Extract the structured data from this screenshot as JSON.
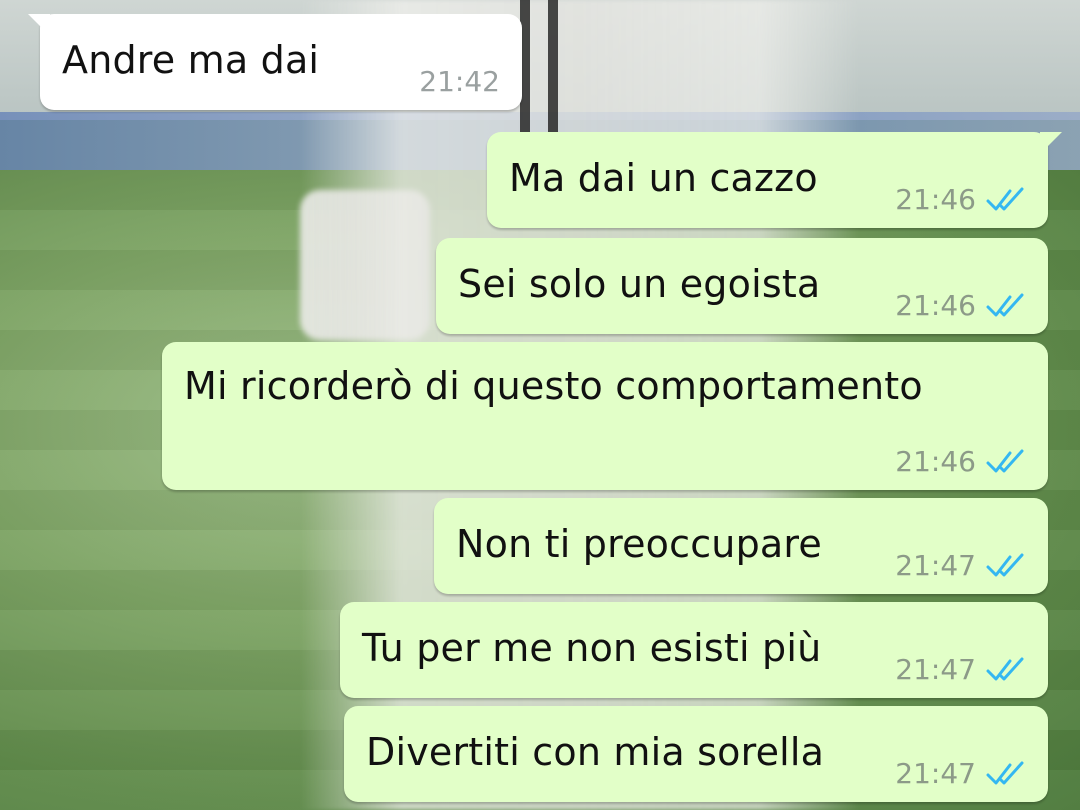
{
  "colors": {
    "incoming_bubble": "#ffffff",
    "outgoing_bubble": "#e2ffc8",
    "read_ticks": "#34b7f1",
    "timestamp": "#8c9a88"
  },
  "messages": [
    {
      "direction": "incoming",
      "text": "Andre ma dai",
      "time": "21:42"
    },
    {
      "direction": "outgoing",
      "text": "Ma dai un cazzo",
      "time": "21:46",
      "status_icon": "double-check-read-icon"
    },
    {
      "direction": "outgoing",
      "text": "Sei solo un egoista",
      "time": "21:46",
      "status_icon": "double-check-read-icon"
    },
    {
      "direction": "outgoing",
      "text": "Mi ricorderò di questo comportamento",
      "time": "21:46",
      "status_icon": "double-check-read-icon"
    },
    {
      "direction": "outgoing",
      "text": "Non ti preoccupare",
      "time": "21:47",
      "status_icon": "double-check-read-icon"
    },
    {
      "direction": "outgoing",
      "text": "Tu per me non esisti più",
      "time": "21:47",
      "status_icon": "double-check-read-icon"
    },
    {
      "direction": "outgoing",
      "text": "Divertiti con mia sorella",
      "time": "21:47",
      "status_icon": "double-check-read-icon"
    }
  ]
}
